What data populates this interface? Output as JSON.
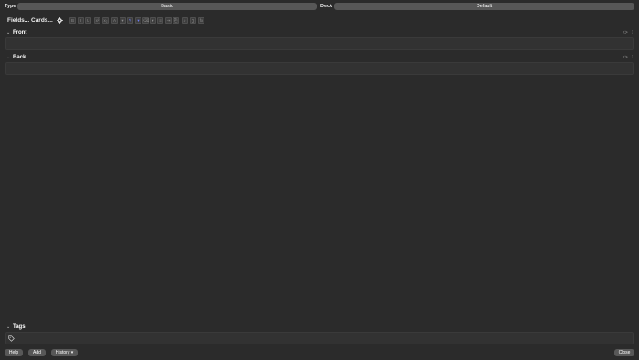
{
  "top": {
    "type_label": "Type",
    "type_value": "Basic",
    "deck_label": "Deck",
    "deck_value": "Default"
  },
  "toolbar": {
    "fields_label": "Fields...",
    "cards_label": "Cards...",
    "format_buttons": [
      {
        "name": "bold",
        "glyph": "B"
      },
      {
        "name": "italic",
        "glyph": "I"
      },
      {
        "name": "underline",
        "glyph": "U"
      },
      {
        "name": "superscript",
        "glyph": "x²"
      },
      {
        "name": "subscript",
        "glyph": "x₂"
      },
      {
        "name": "text-color",
        "glyph": "A"
      },
      {
        "name": "text-color-dropdown",
        "glyph": "▾"
      },
      {
        "name": "highlight",
        "glyph": "✎"
      },
      {
        "name": "highlight-dropdown",
        "glyph": "▾"
      },
      {
        "name": "eraser",
        "glyph": "⌫"
      },
      {
        "name": "more",
        "glyph": "▾"
      },
      {
        "name": "list",
        "glyph": "≡"
      },
      {
        "name": "indent",
        "glyph": "⇥"
      },
      {
        "name": "attach",
        "glyph": "⎘"
      },
      {
        "name": "sound",
        "glyph": "♪"
      },
      {
        "name": "math",
        "glyph": "∑"
      },
      {
        "name": "format",
        "glyph": "fx"
      }
    ]
  },
  "fields": [
    {
      "name": "Front"
    },
    {
      "name": "Back"
    }
  ],
  "tags": {
    "label": "Tags"
  },
  "bottom": {
    "help": "Help",
    "add": "Add",
    "history": "History ▾",
    "close": "Close"
  },
  "colors": {
    "background": "#2b2b2b",
    "button": "#575757",
    "field": "#323232",
    "accent": "#6c7bf7"
  }
}
